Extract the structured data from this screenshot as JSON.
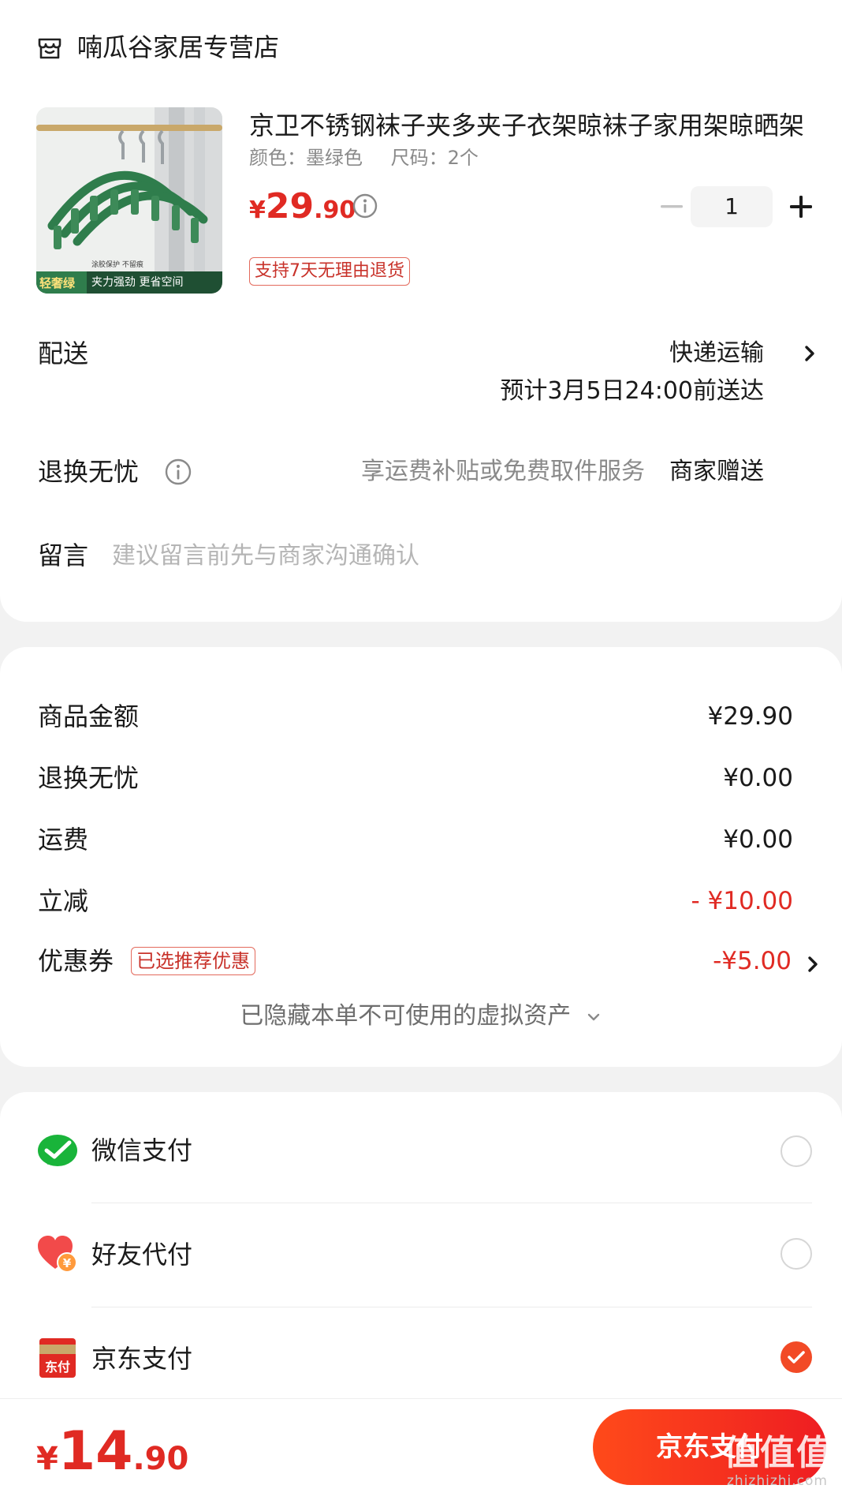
{
  "store": {
    "name": "喃瓜谷家居专营店",
    "icon": "store-icon"
  },
  "product": {
    "title": "京卫不锈钢袜子夹多夹子衣架晾袜子家用架晾晒架",
    "color_spec": "颜色：墨绿色",
    "size_spec": "尺码：2个",
    "price": {
      "symbol": "¥",
      "integer": "29",
      "decimal": ".90"
    },
    "quantity": "1",
    "return_tag": "支持7天无理由退货",
    "image": {
      "badge_green": "轻奢绿",
      "caption_small": "涂胶保护 不留痕",
      "caption_main": "夹力强劲 更省空间",
      "product_color": "#2f7d4c"
    }
  },
  "delivery": {
    "label": "配送",
    "method": "快递运输",
    "eta": "预计3月5日24:00前送达"
  },
  "worry_free": {
    "label": "退换无忧",
    "description": "享运费补贴或免费取件服务",
    "value": "商家赠送"
  },
  "note": {
    "label": "留言",
    "placeholder": "建议留言前先与商家沟通确认"
  },
  "amounts": {
    "rows": [
      {
        "label": "商品金额",
        "value": "¥29.90"
      },
      {
        "label": "退换无忧",
        "value": "¥0.00"
      },
      {
        "label": "运费",
        "value": "¥0.00"
      },
      {
        "label": "立减",
        "value": "- ¥10.00"
      },
      {
        "label": "优惠券",
        "value": "-¥5.00"
      }
    ],
    "coupon_badge": "已选推荐优惠",
    "hidden_assets": "已隐藏本单不可使用的虚拟资产"
  },
  "payment_methods": [
    {
      "label": "微信支付",
      "icon": "wechat-pay-icon",
      "selected": false
    },
    {
      "label": "好友代付",
      "icon": "friend-pay-heart-icon",
      "selected": false
    },
    {
      "label": "京东支付",
      "icon": "jd-pay-icon",
      "icon_text": "东付",
      "selected": true
    }
  ],
  "bottom": {
    "total": {
      "symbol": "¥",
      "integer": "14",
      "decimal": ".90"
    },
    "pay_button": "京东支付",
    "watermark": "值值值",
    "watermark_url": "zhizhizhi.com"
  },
  "colors": {
    "accent_red": "#e02a23",
    "button_gradient_start": "#ff4a1a",
    "button_gradient_end": "#ee1d22",
    "wechat_green": "#19b43a",
    "radio_checked": "#f24a26"
  }
}
